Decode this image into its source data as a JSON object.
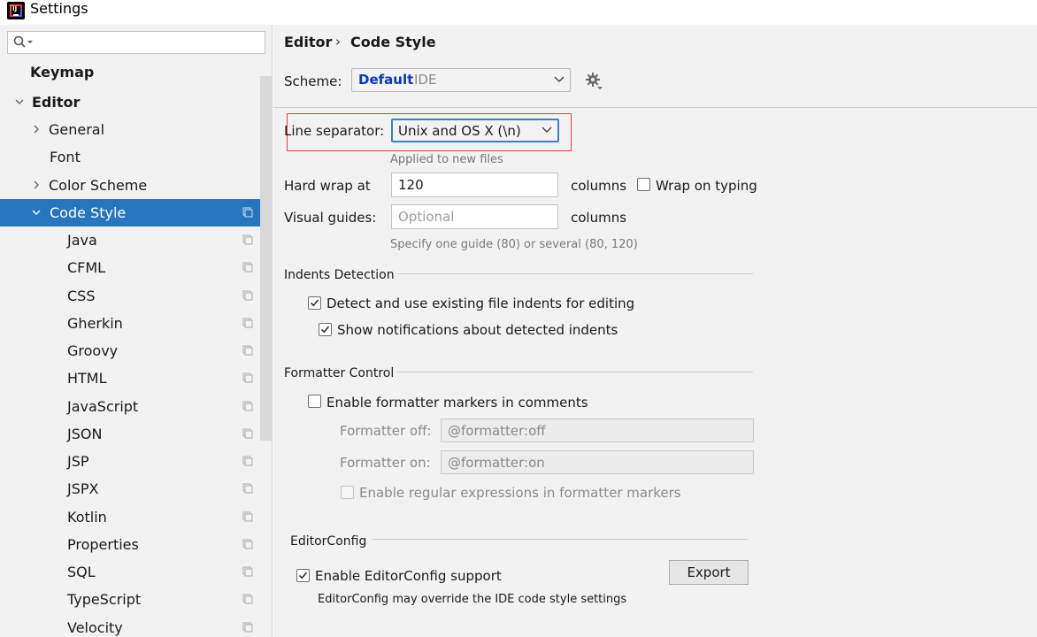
{
  "window": {
    "title": "Settings"
  },
  "sidebar": {
    "search_placeholder": "",
    "items": [
      {
        "label": "Keymap"
      },
      {
        "label": "Editor"
      },
      {
        "label": "General"
      },
      {
        "label": "Font"
      },
      {
        "label": "Color Scheme"
      },
      {
        "label": "Code Style"
      },
      {
        "label": "Java"
      },
      {
        "label": "CFML"
      },
      {
        "label": "CSS"
      },
      {
        "label": "Gherkin"
      },
      {
        "label": "Groovy"
      },
      {
        "label": "HTML"
      },
      {
        "label": "JavaScript"
      },
      {
        "label": "JSON"
      },
      {
        "label": "JSP"
      },
      {
        "label": "JSPX"
      },
      {
        "label": "Kotlin"
      },
      {
        "label": "Properties"
      },
      {
        "label": "SQL"
      },
      {
        "label": "TypeScript"
      },
      {
        "label": "Velocity"
      }
    ]
  },
  "breadcrumb": {
    "parent": "Editor",
    "separator": "›",
    "current": "Code Style"
  },
  "scheme": {
    "label": "Scheme:",
    "name": "Default",
    "type": "IDE"
  },
  "line_separator": {
    "label": "Line separator:",
    "value": "Unix and OS X (\\n)",
    "hint": "Applied to new files"
  },
  "hard_wrap": {
    "label": "Hard wrap at",
    "value": "120",
    "suffix": "columns",
    "wrap_on_typing": "Wrap on typing"
  },
  "visual_guides": {
    "label": "Visual guides:",
    "placeholder": "Optional",
    "suffix": "columns",
    "hint": "Specify one guide (80) or several (80, 120)"
  },
  "indents_detection": {
    "title": "Indents Detection",
    "detect_label": "Detect and use existing file indents for editing",
    "notify_label": "Show notifications about detected indents"
  },
  "formatter_control": {
    "title": "Formatter Control",
    "enable_label": "Enable formatter markers in comments",
    "off_label": "Formatter off:",
    "off_value": "@formatter:off",
    "on_label": "Formatter on:",
    "on_value": "@formatter:on",
    "regex_label": "Enable regular expressions in formatter markers"
  },
  "editorconfig": {
    "title": "EditorConfig",
    "enable_label": "Enable EditorConfig support",
    "export_label": "Export",
    "note": "EditorConfig may override the IDE code style settings"
  },
  "colors": {
    "selection": "#2675bf",
    "scheme_name": "#0a34c4",
    "highlight_box": "#e0403c"
  }
}
